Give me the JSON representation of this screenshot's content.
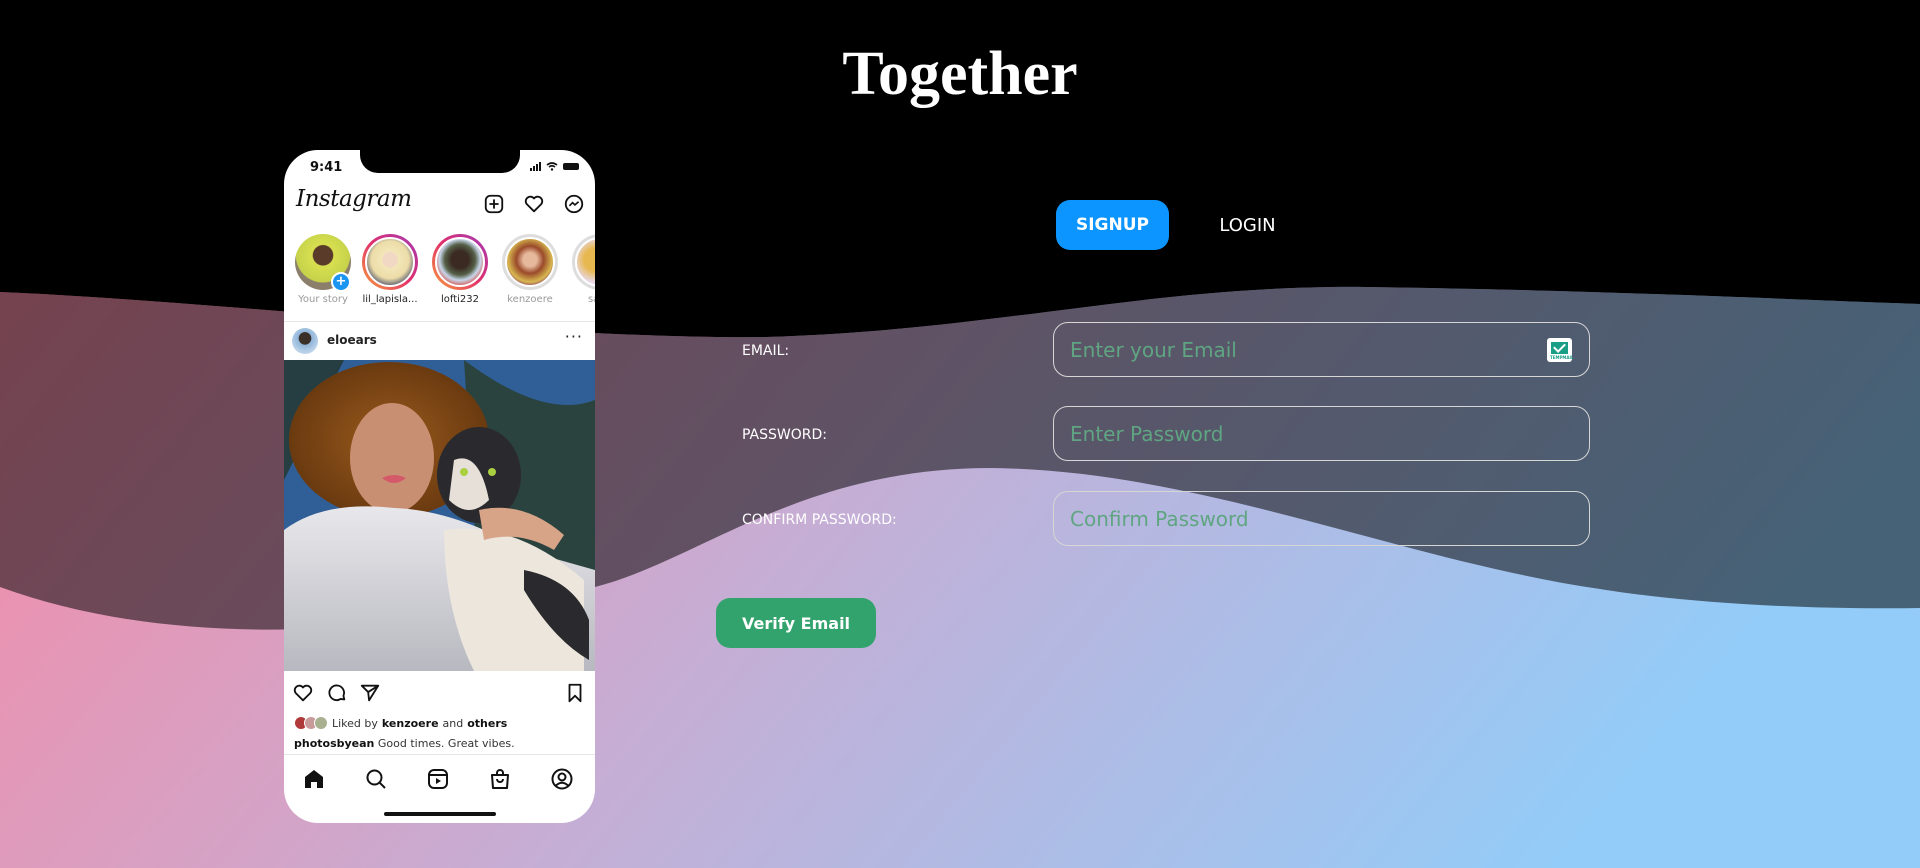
{
  "page": {
    "title": "Together"
  },
  "colors": {
    "signup_tab": "#0d95ff",
    "verify_button": "#33a36d",
    "placeholder": "#5fa582",
    "gradient_left": "#f68aa5",
    "gradient_mid": "#c5aed5",
    "gradient_right": "#93ccf8",
    "header_bg": "#000000"
  },
  "auth_tabs": {
    "signup": "SIGNUP",
    "login": "LOGIN",
    "active": "signup"
  },
  "form": {
    "email": {
      "label": "EMAIL:",
      "placeholder": "Enter your Email",
      "value": "",
      "icon": "tempmail-icon",
      "icon_brand": "TEMPMAIL"
    },
    "password": {
      "label": "PASSWORD:",
      "placeholder": "Enter Password",
      "value": ""
    },
    "confirm_password": {
      "label": "CONFIRM PASSWORD:",
      "placeholder": "Confirm Password",
      "value": ""
    },
    "verify_button": "Verify Email"
  },
  "phone_mockup": {
    "time": "9:41",
    "app_name": "Instagram",
    "header_icons": [
      "new-post-icon",
      "heart-icon",
      "messenger-icon"
    ],
    "stories": [
      {
        "name": "Your story",
        "own": true
      },
      {
        "name": "lil_lapisla...",
        "own": false
      },
      {
        "name": "lofti232",
        "own": false
      },
      {
        "name": "kenzoere",
        "own": false
      },
      {
        "name": "sapp",
        "own": false
      }
    ],
    "post": {
      "username": "eloears",
      "more": "···",
      "liked_prefix": "Liked by",
      "liked_user": "kenzoere",
      "liked_and": "and",
      "liked_others": "others",
      "caption_user": "photosbyean",
      "caption_text": "Good times. Great vibes."
    },
    "nav_icons": [
      "home-icon",
      "search-icon",
      "reels-icon",
      "shop-icon",
      "profile-icon"
    ]
  }
}
